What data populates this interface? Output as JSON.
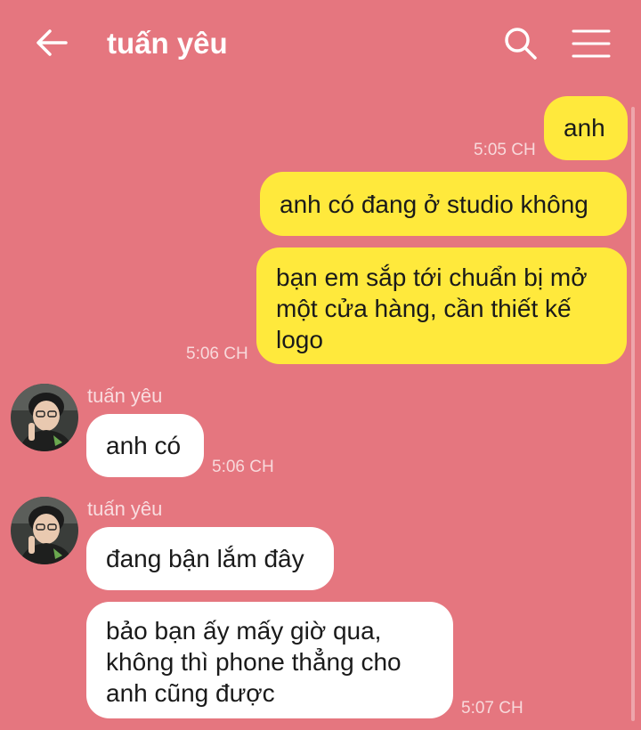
{
  "header": {
    "title": "tuấn yêu",
    "back_icon": "arrow-left-icon",
    "search_icon": "search-icon",
    "menu_icon": "menu-icon"
  },
  "colors": {
    "background": "#e5767f",
    "my_bubble": "#ffe93c",
    "their_bubble": "#ffffff"
  },
  "messages": [
    {
      "from": "me",
      "text": "anh",
      "time": "5:05 CH"
    },
    {
      "from": "me",
      "text": "anh có đang ở studio không"
    },
    {
      "from": "me",
      "lines": [
        "bạn em sắp tới chuẩn bị mở",
        "một cửa hàng, cần thiết kế",
        "logo"
      ],
      "time": "5:06 CH"
    },
    {
      "from": "them",
      "sender": "tuấn yêu",
      "text": "anh có",
      "time": "5:06 CH"
    },
    {
      "from": "them",
      "sender": "tuấn yêu",
      "text": "đang bận lắm đây"
    },
    {
      "from": "them",
      "lines": [
        "bảo bạn ấy mấy giờ qua,",
        "không thì phone thẳng cho",
        "anh cũng được"
      ],
      "time": "5:07 CH"
    }
  ]
}
